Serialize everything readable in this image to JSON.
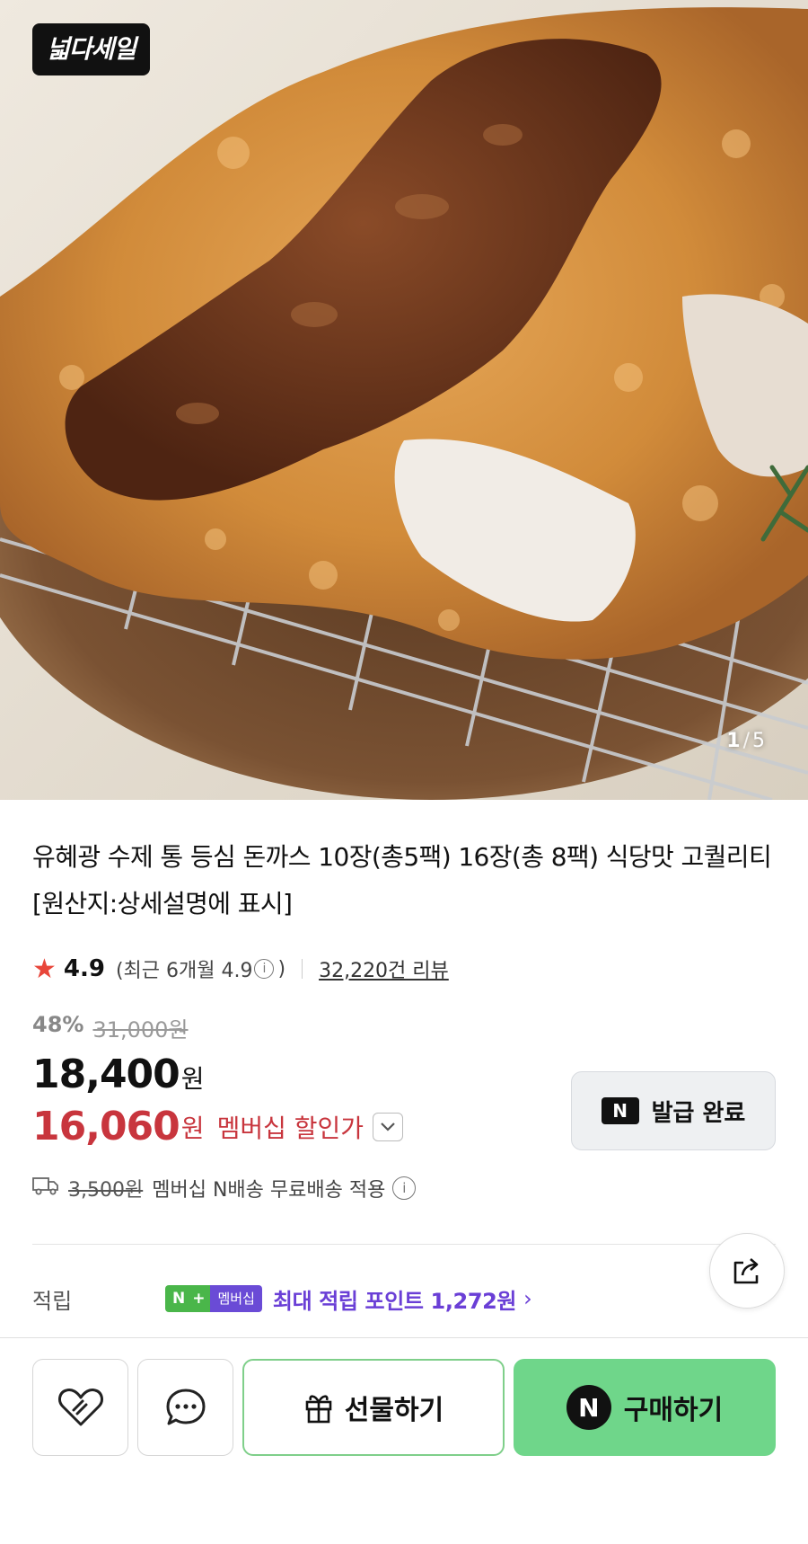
{
  "hero": {
    "badge_label": "넓다세일",
    "counter": {
      "current": "1",
      "separator": "/",
      "total": "5"
    }
  },
  "product": {
    "title": "유혜광 수제 통 등심 돈까스 10장(총5팩) 16장(총 8팩) 식당맛 고퀄리티 [원산지:상세설명에 표시]"
  },
  "rating": {
    "score": "4.9",
    "recent_open": "(최근 6개월 4.9",
    "recent_close": ")",
    "info_symbol": "i",
    "review_count": "32,220건 리뷰"
  },
  "pricing": {
    "discount_pct": "48%",
    "original_price": "31,000원",
    "price": "18,400",
    "price_unit": "원",
    "member_price": "16,060",
    "member_price_unit": "원",
    "member_label": "멤버십 할인가",
    "coupon_label": "발급 완료",
    "coupon_logo": "N"
  },
  "shipping": {
    "old_fee": "3,500원",
    "text": "멤버십 N배송 무료배송 적용",
    "info_symbol": "i"
  },
  "points": {
    "label": "적립",
    "badge_n": "N",
    "badge_plus": "+",
    "badge_member": "멤버십",
    "text": "최대 적립 포인트 1,272원",
    "arrow": "›"
  },
  "actions": {
    "gift_label": "선물하기",
    "buy_label": "구매하기",
    "buy_logo": "N"
  },
  "colors": {
    "accent_red": "#c8353d",
    "star_red": "#e8463a",
    "points_purple": "#6a3fd6",
    "buy_green": "#6fd68a",
    "gift_border_green": "#7fcf8a"
  }
}
